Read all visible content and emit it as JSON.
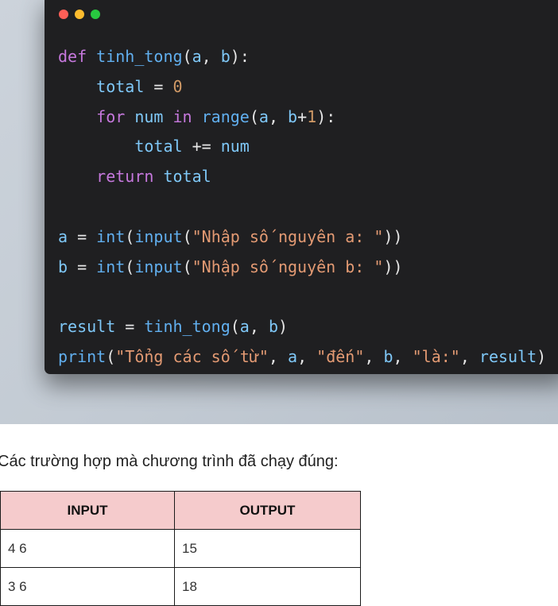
{
  "window": {
    "dots": [
      {
        "name": "close",
        "color": "#ff5f57"
      },
      {
        "name": "minimize",
        "color": "#febc2e"
      },
      {
        "name": "maximize",
        "color": "#28c840"
      }
    ]
  },
  "code": {
    "lines": [
      [
        {
          "t": "def ",
          "c": "kw"
        },
        {
          "t": "tinh_tong",
          "c": "fn"
        },
        {
          "t": "(",
          "c": "pl"
        },
        {
          "t": "a",
          "c": "var"
        },
        {
          "t": ", ",
          "c": "pl"
        },
        {
          "t": "b",
          "c": "var"
        },
        {
          "t": "):",
          "c": "pl"
        }
      ],
      [
        {
          "t": "    ",
          "c": "pl"
        },
        {
          "t": "total",
          "c": "var"
        },
        {
          "t": " = ",
          "c": "pl"
        },
        {
          "t": "0",
          "c": "num"
        }
      ],
      [
        {
          "t": "    ",
          "c": "pl"
        },
        {
          "t": "for ",
          "c": "kw"
        },
        {
          "t": "num ",
          "c": "var"
        },
        {
          "t": "in ",
          "c": "kw"
        },
        {
          "t": "range",
          "c": "fn"
        },
        {
          "t": "(",
          "c": "pl"
        },
        {
          "t": "a",
          "c": "var"
        },
        {
          "t": ", ",
          "c": "pl"
        },
        {
          "t": "b",
          "c": "var"
        },
        {
          "t": "+",
          "c": "pl"
        },
        {
          "t": "1",
          "c": "num"
        },
        {
          "t": "):",
          "c": "pl"
        }
      ],
      [
        {
          "t": "        ",
          "c": "pl"
        },
        {
          "t": "total",
          "c": "var"
        },
        {
          "t": " += ",
          "c": "pl"
        },
        {
          "t": "num",
          "c": "var"
        }
      ],
      [
        {
          "t": "    ",
          "c": "pl"
        },
        {
          "t": "return ",
          "c": "kw"
        },
        {
          "t": "total",
          "c": "var"
        }
      ],
      [],
      [
        {
          "t": "a",
          "c": "var"
        },
        {
          "t": " = ",
          "c": "pl"
        },
        {
          "t": "int",
          "c": "fn"
        },
        {
          "t": "(",
          "c": "pl"
        },
        {
          "t": "input",
          "c": "fn"
        },
        {
          "t": "(",
          "c": "pl"
        },
        {
          "t": "\"Nhập số nguyên a: \"",
          "c": "str"
        },
        {
          "t": "))",
          "c": "pl"
        }
      ],
      [
        {
          "t": "b",
          "c": "var"
        },
        {
          "t": " = ",
          "c": "pl"
        },
        {
          "t": "int",
          "c": "fn"
        },
        {
          "t": "(",
          "c": "pl"
        },
        {
          "t": "input",
          "c": "fn"
        },
        {
          "t": "(",
          "c": "pl"
        },
        {
          "t": "\"Nhập số nguyên b: \"",
          "c": "str"
        },
        {
          "t": "))",
          "c": "pl"
        }
      ],
      [],
      [
        {
          "t": "result",
          "c": "var"
        },
        {
          "t": " = ",
          "c": "pl"
        },
        {
          "t": "tinh_tong",
          "c": "fn"
        },
        {
          "t": "(",
          "c": "pl"
        },
        {
          "t": "a",
          "c": "var"
        },
        {
          "t": ", ",
          "c": "pl"
        },
        {
          "t": "b",
          "c": "var"
        },
        {
          "t": ")",
          "c": "pl"
        }
      ],
      [
        {
          "t": "print",
          "c": "fn"
        },
        {
          "t": "(",
          "c": "pl"
        },
        {
          "t": "\"Tổng các số từ\"",
          "c": "str"
        },
        {
          "t": ", ",
          "c": "pl"
        },
        {
          "t": "a",
          "c": "var"
        },
        {
          "t": ", ",
          "c": "pl"
        },
        {
          "t": "\"đến\"",
          "c": "str"
        },
        {
          "t": ", ",
          "c": "pl"
        },
        {
          "t": "b",
          "c": "var"
        },
        {
          "t": ", ",
          "c": "pl"
        },
        {
          "t": "\"là:\"",
          "c": "str"
        },
        {
          "t": ", ",
          "c": "pl"
        },
        {
          "t": "result",
          "c": "var"
        },
        {
          "t": ")",
          "c": "pl"
        }
      ]
    ]
  },
  "caption": "Các trường hợp mà chương trình đã chạy đúng:",
  "table": {
    "headers": [
      "INPUT",
      "OUTPUT"
    ],
    "rows": [
      [
        "4 6",
        "15"
      ],
      [
        "3 6",
        "18"
      ]
    ],
    "header_bg": "#f5cbcc"
  }
}
